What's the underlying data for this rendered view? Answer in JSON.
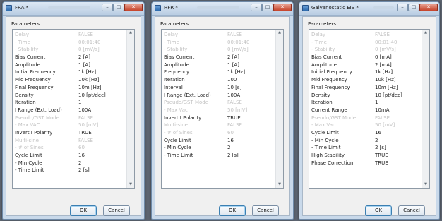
{
  "windows": [
    {
      "title": "FRA *",
      "params_label": "Parameters",
      "rows": [
        {
          "name": "Delay",
          "value": "FALSE",
          "enabled": false
        },
        {
          "name": "- Time",
          "value": "00:01:40",
          "enabled": false
        },
        {
          "name": "- Stability",
          "value": "0 [mV/s]",
          "enabled": false
        },
        {
          "name": "Bias Current",
          "value": "2 [A]",
          "enabled": true
        },
        {
          "name": "Amplitude",
          "value": "1 [A]",
          "enabled": true
        },
        {
          "name": "Initial Frequency",
          "value": "1k [Hz]",
          "enabled": true
        },
        {
          "name": "Mid Frequency",
          "value": "10k [Hz]",
          "enabled": true
        },
        {
          "name": "Final Frequency",
          "value": "10m [Hz]",
          "enabled": true
        },
        {
          "name": "Density",
          "value": "10 [pt/dec]",
          "enabled": true
        },
        {
          "name": "Iteration",
          "value": "1",
          "enabled": true
        },
        {
          "name": "I Range (Ext. Load)",
          "value": "100A",
          "enabled": true
        },
        {
          "name": "Pseudo/GST Mode",
          "value": "FALSE",
          "enabled": false
        },
        {
          "name": "- Max VAC",
          "value": "50 [mV]",
          "enabled": false
        },
        {
          "name": "Invert I Polarity",
          "value": "TRUE",
          "enabled": true
        },
        {
          "name": "Multi-sine",
          "value": "FALSE",
          "enabled": false
        },
        {
          "name": "- # of Sines",
          "value": "60",
          "enabled": false
        },
        {
          "name": "Cycle Limit",
          "value": "16",
          "enabled": true
        },
        {
          "name": "- Min Cycle",
          "value": "2",
          "enabled": true
        },
        {
          "name": "- Time Limit",
          "value": "2 [s]",
          "enabled": true
        }
      ],
      "ok": "OK",
      "cancel": "Cancel"
    },
    {
      "title": "HFR *",
      "params_label": "Parameters",
      "rows": [
        {
          "name": "Delay",
          "value": "FALSE",
          "enabled": false
        },
        {
          "name": "- Time",
          "value": "00:01:40",
          "enabled": false
        },
        {
          "name": "- Stability",
          "value": "0 [mV/s]",
          "enabled": false
        },
        {
          "name": "Bias Current",
          "value": "2 [A]",
          "enabled": true
        },
        {
          "name": "Amplitude",
          "value": "1 [A]",
          "enabled": true
        },
        {
          "name": "Frequency",
          "value": "1k [Hz]",
          "enabled": true
        },
        {
          "name": "Iteration",
          "value": "100",
          "enabled": true
        },
        {
          "name": "Interval",
          "value": "10 [s]",
          "enabled": true
        },
        {
          "name": "I Range (Ext. Load)",
          "value": "100A",
          "enabled": true
        },
        {
          "name": "Pseudo/GST Mode",
          "value": "FALSE",
          "enabled": false
        },
        {
          "name": "- Max Vac",
          "value": "50 [mV]",
          "enabled": false
        },
        {
          "name": "Invert I Polarity",
          "value": "TRUE",
          "enabled": true
        },
        {
          "name": "Multi-sine",
          "value": "FALSE",
          "enabled": false
        },
        {
          "name": "- # of Sines",
          "value": "60",
          "enabled": false
        },
        {
          "name": "Cycle Limit",
          "value": "16",
          "enabled": true
        },
        {
          "name": "- Min Cycle",
          "value": "2",
          "enabled": true
        },
        {
          "name": "- Time Limit",
          "value": "2 [s]",
          "enabled": true
        }
      ],
      "ok": "OK",
      "cancel": "Cancel"
    },
    {
      "title": "Galvanostatic EIS *",
      "params_label": "Parameters",
      "rows": [
        {
          "name": "Delay",
          "value": "FALSE",
          "enabled": false
        },
        {
          "name": "- Time",
          "value": "00:01:40",
          "enabled": false
        },
        {
          "name": "- Stability",
          "value": "0 [mV/s]",
          "enabled": false
        },
        {
          "name": "Bias Current",
          "value": "0 [mA]",
          "enabled": true
        },
        {
          "name": "Amplitude",
          "value": "2 [mA]",
          "enabled": true
        },
        {
          "name": "Initial Frequency",
          "value": "1k [Hz]",
          "enabled": true
        },
        {
          "name": "Mid Frequency",
          "value": "10k [Hz]",
          "enabled": true
        },
        {
          "name": "Final Frequency",
          "value": "10m [Hz]",
          "enabled": true
        },
        {
          "name": "Density",
          "value": "10 [pt/dec]",
          "enabled": true
        },
        {
          "name": "Iteration",
          "value": "1",
          "enabled": true
        },
        {
          "name": "Current Range",
          "value": "10mA",
          "enabled": true
        },
        {
          "name": "Pseudo/GST Mode",
          "value": "FALSE",
          "enabled": false
        },
        {
          "name": "- Max Vac",
          "value": "50 [mV]",
          "enabled": false
        },
        {
          "name": "Cycle Limit",
          "value": "16",
          "enabled": true
        },
        {
          "name": "- Min Cycle",
          "value": "2",
          "enabled": true
        },
        {
          "name": "- Time Limit",
          "value": "2 [s]",
          "enabled": true
        },
        {
          "name": "High Stability",
          "value": "TRUE",
          "enabled": true
        },
        {
          "name": "Phase Correction",
          "value": "TRUE",
          "enabled": true
        }
      ],
      "ok": "OK",
      "cancel": "Cancel"
    }
  ],
  "icons": {
    "minimize": "minimize-icon",
    "maximize": "maximize-icon",
    "close": "close-icon",
    "scroll_up": "chevron-up-icon",
    "scroll_down": "chevron-down-icon"
  },
  "colors": {
    "desktop": "#5c6470",
    "frame": "#c9d9ea",
    "disabled_text": "#c3c3c3",
    "close_button": "#c5432a"
  }
}
